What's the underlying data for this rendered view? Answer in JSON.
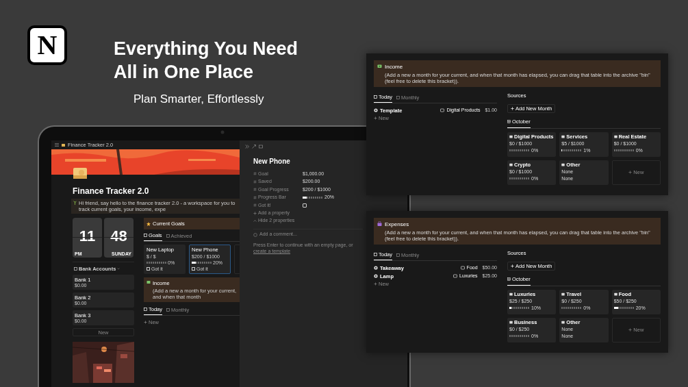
{
  "logo": {
    "letter": "N"
  },
  "headline": [
    "Everything You Need",
    "All in One Place"
  ],
  "subheadline": "Plan Smarter, Effortlessly",
  "laptop": {
    "breadcrumb": "Finance Tracker 2.0",
    "page_title": "Finance Tracker 2.0",
    "intro": "Hi friend, say hello to the finance tracker 2.0 - a workspace for you to track current goals, your income, expe",
    "clock": {
      "hour": "11",
      "minute": "48",
      "period": "PM",
      "day": "SUNDAY"
    },
    "bank_accounts": {
      "title": "Bank Accounts",
      "items": [
        {
          "name": "Bank 1",
          "amount": "$0.00"
        },
        {
          "name": "Bank 2",
          "amount": "$0.00"
        },
        {
          "name": "Bank 3",
          "amount": "$0.00"
        }
      ],
      "new": "New"
    },
    "goals": {
      "title": "Current Goals",
      "tabs": [
        {
          "label": "Goals",
          "selected": true
        },
        {
          "label": "Achieved",
          "selected": false
        }
      ],
      "cards": [
        {
          "name": "New Laptop",
          "amount": "$ / $",
          "level": 0,
          "reading": "0%",
          "check_label": "Got it",
          "checked": false,
          "selected": false
        },
        {
          "name": "New Phone",
          "amount": "$200 / $1000",
          "level": 0.2,
          "reading": "20%",
          "check_label": "Got it",
          "checked": false,
          "selected": true
        }
      ]
    },
    "income": {
      "title": "Income",
      "note": "(Add a new a month for your current, and when that month",
      "tabs": [
        {
          "label": "Today",
          "selected": true
        },
        {
          "label": "Monthly",
          "selected": false
        }
      ],
      "new": "New"
    },
    "peek": {
      "title": "New Phone",
      "properties": [
        {
          "kind": "text",
          "label": "Goal",
          "value": "$1,000.00"
        },
        {
          "kind": "text",
          "label": "Saved",
          "value": "$200.00"
        },
        {
          "kind": "text",
          "label": "Goal Progress",
          "value": "$200 / $1000"
        },
        {
          "kind": "bar",
          "label": "Progress Bar",
          "level": 0.2,
          "reading": "20%"
        },
        {
          "kind": "checkbox",
          "label": "Got it!",
          "checked": false
        }
      ],
      "add_property": "Add a property",
      "hide_properties": "Hide 2 properties",
      "comment_placeholder": "Add a comment...",
      "hint": "Press Enter to continue with an empty page, or",
      "hint_link": "create a template"
    }
  },
  "panels": [
    {
      "title": "Income",
      "note": "(Add a new a month for your current, and when that month has elapsed, you can drag that table into the archive \"bin\" (feel free to delete this bracket)).",
      "tabs": [
        {
          "label": "Today",
          "selected": true
        },
        {
          "label": "Monthly",
          "selected": false
        }
      ],
      "entries": [
        {
          "name": "Template",
          "category": "Digital Products",
          "amount": "$1.00"
        }
      ],
      "new": "New",
      "sources_title": "Sources",
      "add_month": "Add New Month",
      "view_tab": "October",
      "cards": [
        {
          "name": "Digital Products",
          "amount": "$0 / $1000",
          "level": 0,
          "reading": "0%"
        },
        {
          "name": "Services",
          "amount": "$5 / $1000",
          "level": 0.01,
          "reading": "1%"
        },
        {
          "name": "Real Estate",
          "amount": "$0 / $1000",
          "level": 0,
          "reading": "0%"
        },
        {
          "name": "Crypto",
          "amount": "$0 / $1000",
          "level": 0,
          "reading": "0%"
        },
        {
          "name": "Other",
          "amount": "None",
          "note": "None"
        }
      ],
      "card_new": "New"
    },
    {
      "title": "Expenses",
      "note": "(Add a new a month for your current, and when that month has elapsed, you can drag that table into the archive \"bin\" (feel free to delete this bracket)).",
      "tabs": [
        {
          "label": "Today",
          "selected": true
        },
        {
          "label": "Monthly",
          "selected": false
        }
      ],
      "entries": [
        {
          "name": "Takeaway",
          "category": "Food",
          "amount": "$50.00"
        },
        {
          "name": "Lamp",
          "category": "Luxuries",
          "amount": "$25.00"
        }
      ],
      "new": "New",
      "sources_title": "Sources",
      "add_month": "Add New Month",
      "view_tab": "October",
      "cards": [
        {
          "name": "Luxuries",
          "amount": "$25 / $250",
          "level": 0.1,
          "reading": "10%"
        },
        {
          "name": "Travel",
          "amount": "$0 / $250",
          "level": 0,
          "reading": "0%"
        },
        {
          "name": "Food",
          "amount": "$50 / $250",
          "level": 0.2,
          "reading": "20%"
        },
        {
          "name": "Business",
          "amount": "$0 / $250",
          "level": 0,
          "reading": "0%"
        },
        {
          "name": "Other",
          "amount": "None",
          "note": "None"
        }
      ],
      "card_new": "New"
    }
  ]
}
